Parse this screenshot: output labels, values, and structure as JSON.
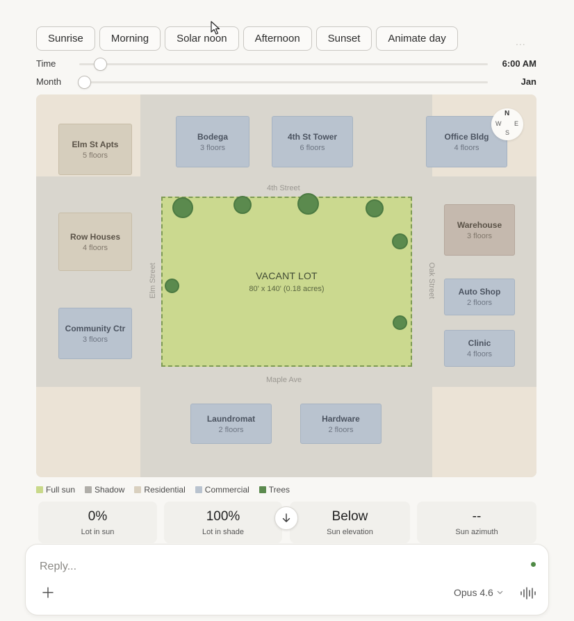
{
  "presets": [
    {
      "label": "Sunrise"
    },
    {
      "label": "Morning"
    },
    {
      "label": "Solar noon"
    },
    {
      "label": "Afternoon"
    },
    {
      "label": "Sunset"
    },
    {
      "label": "Animate day"
    }
  ],
  "more_label": "...",
  "time_slider": {
    "label": "Time",
    "value": "6:00 AM",
    "fraction": 0.0
  },
  "month_slider": {
    "label": "Month",
    "value": "Jan",
    "fraction": 0.0
  },
  "map": {
    "buildings": {
      "elm_st_apts": {
        "name": "Elm St Apts",
        "floors": "5 floors"
      },
      "bodega": {
        "name": "Bodega",
        "floors": "3 floors"
      },
      "fourth_st_tower": {
        "name": "4th St Tower",
        "floors": "6 floors"
      },
      "office_bldg": {
        "name": "Office Bldg",
        "floors": "4 floors"
      },
      "row_houses": {
        "name": "Row Houses",
        "floors": "4 floors"
      },
      "warehouse": {
        "name": "Warehouse",
        "floors": "3 floors"
      },
      "auto_shop": {
        "name": "Auto Shop",
        "floors": "2 floors"
      },
      "community_ctr": {
        "name": "Community Ctr",
        "floors": "3 floors"
      },
      "clinic": {
        "name": "Clinic",
        "floors": "4 floors"
      },
      "laundromat": {
        "name": "Laundromat",
        "floors": "2 floors"
      },
      "hardware": {
        "name": "Hardware",
        "floors": "2 floors"
      }
    },
    "streets": {
      "fourth": "4th Street",
      "elm": "Elm Street",
      "oak": "Oak Street",
      "maple": "Maple Ave"
    },
    "lot": {
      "title": "VACANT LOT",
      "size": "80' x 140' (0.18 acres)"
    },
    "compass": {
      "n": "N",
      "w": "W",
      "e": "E",
      "s": "S"
    }
  },
  "legend": [
    {
      "label": "Full sun",
      "color": "#c9d98a"
    },
    {
      "label": "Shadow",
      "color": "#b0aea9"
    },
    {
      "label": "Residential",
      "color": "#d9d0bf"
    },
    {
      "label": "Commercial",
      "color": "#b9c3cf"
    },
    {
      "label": "Trees",
      "color": "#5b8a4e"
    }
  ],
  "stats": {
    "lot_in_sun": {
      "value": "0%",
      "label": "Lot in sun"
    },
    "lot_in_shade": {
      "value": "100%",
      "label": "Lot in shade"
    },
    "sun_elevation": {
      "value": "Below",
      "label": "Sun elevation"
    },
    "sun_azimuth": {
      "value": "--",
      "label": "Sun azimuth"
    }
  },
  "composer": {
    "placeholder": "Reply...",
    "model": "Opus 4.6"
  },
  "colors": {
    "accent_green": "#4f8a45",
    "lot_fill": "#cbd98f"
  }
}
